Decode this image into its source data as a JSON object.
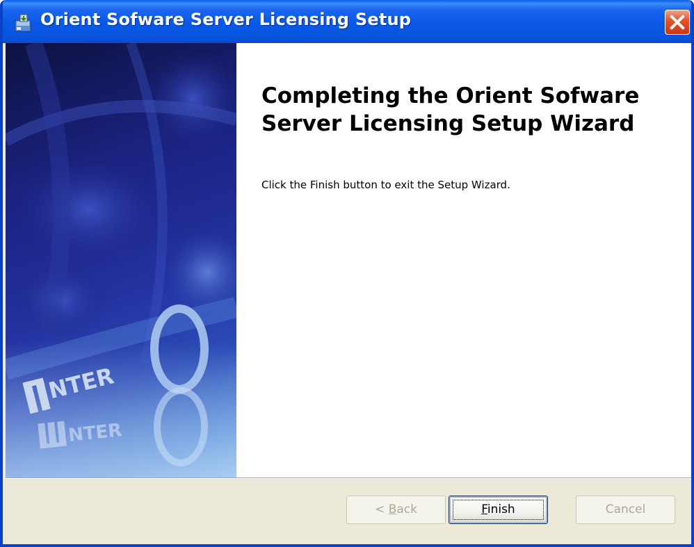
{
  "window": {
    "title": "Orient Sofware Server Licensing Setup",
    "close_label": "Close"
  },
  "banner": {
    "logo_text_main": "NTER",
    "logo_text_reflection": "NTER",
    "colors": {
      "dark": "#0d1140",
      "mid": "#23309e",
      "light": "#7ab2ea"
    }
  },
  "content": {
    "heading": "Completing the Orient Sofware Server Licensing Setup Wizard",
    "body": "Click the Finish button to exit the Setup Wizard."
  },
  "buttons": {
    "back": {
      "prefix": "< ",
      "mnemonic": "B",
      "rest": "ack",
      "enabled": false
    },
    "finish": {
      "prefix": "",
      "mnemonic": "F",
      "rest": "inish",
      "enabled": true,
      "default": true
    },
    "cancel": {
      "label": "Cancel",
      "enabled": false
    }
  },
  "colors": {
    "titlebar": "#0a58e6",
    "dialog_face": "#ece9d8",
    "close_button": "#e2552f"
  }
}
